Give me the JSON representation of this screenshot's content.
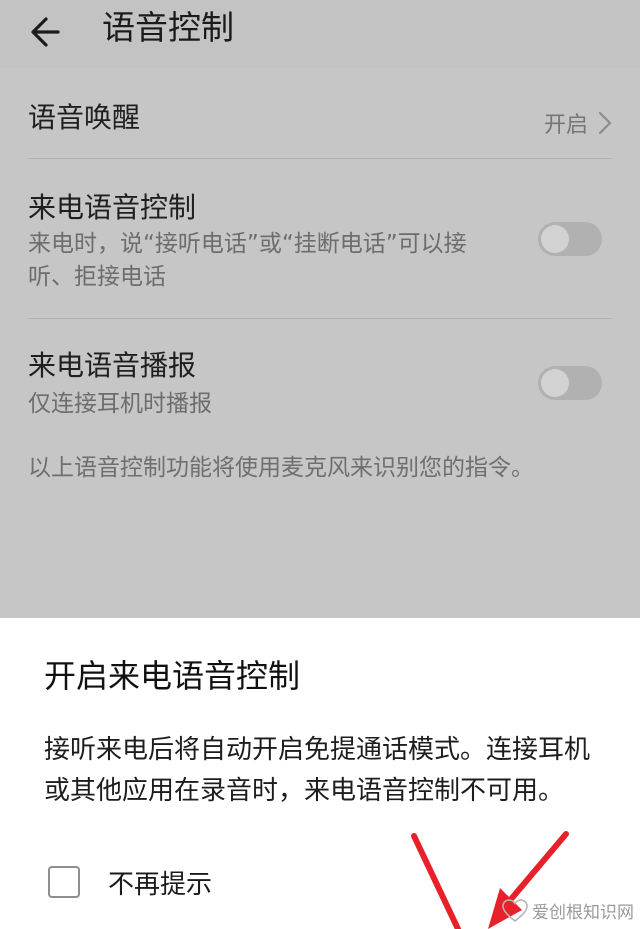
{
  "header": {
    "title": "语音控制",
    "back_icon": "back-arrow-icon"
  },
  "settings": {
    "voice_wakeup": {
      "label": "语音唤醒",
      "value": "开启",
      "chevron_icon": "chevron-right-icon"
    },
    "incoming_call_voice_control": {
      "label": "来电语音控制",
      "description": "来电时，说“接听电话”或“挂断电话”可以接听、拒接电话",
      "enabled": false
    },
    "incoming_call_announcement": {
      "label": "来电语音播报",
      "description": "仅连接耳机时播报",
      "enabled": false
    },
    "footnote": "以上语音控制功能将使用麦克风来识别您的指令。"
  },
  "dialog": {
    "title": "开启来电语音控制",
    "body": "接听来电后将自动开启免提通话模式。连接耳机或其他应用在录音时，来电语音控制不可用。",
    "checkbox_label": "不再提示",
    "checkbox_checked": false
  },
  "annotation": {
    "color": "#e8202a",
    "icon": "red-arrow-annotation"
  },
  "watermark": {
    "text": "爱创根知识网"
  },
  "colors": {
    "dim_background": "#c6c6c6",
    "dialog_background": "#ffffff",
    "toggle_track": "#b1b1b1"
  }
}
